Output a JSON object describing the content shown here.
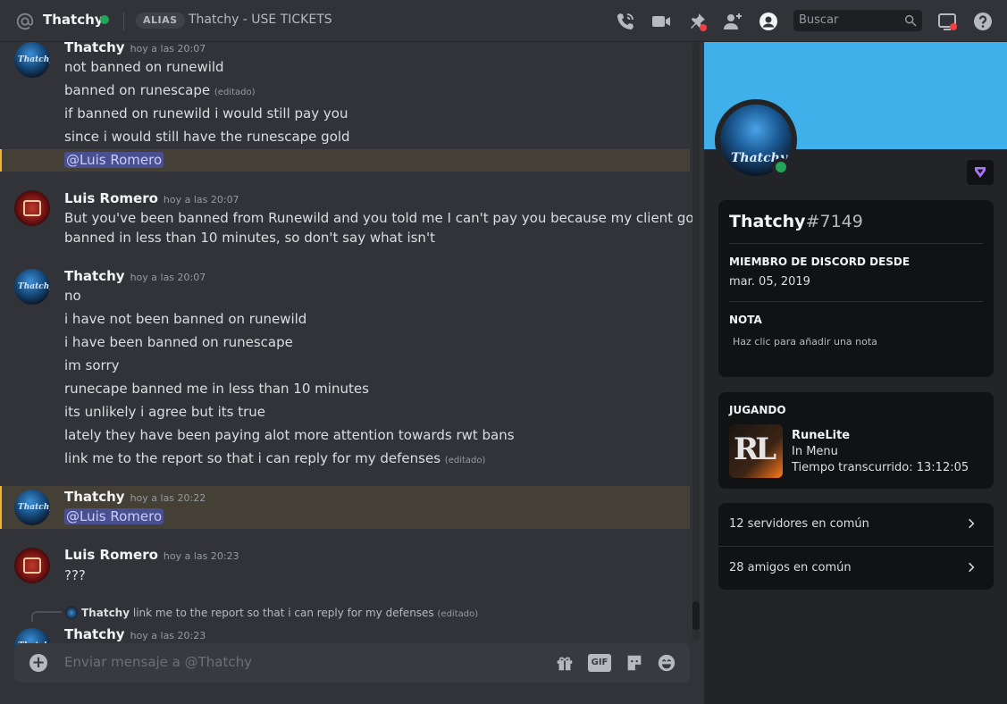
{
  "header": {
    "name": "Thatchy",
    "alias_tag": "ALIAS",
    "alias_text": "Thatchy - USE TICKETS",
    "search_placeholder": "Buscar",
    "icons": [
      "phone-call-icon",
      "video-call-icon",
      "pin-icon",
      "add-friend-icon",
      "profile-icon",
      "inbox-icon",
      "help-icon"
    ]
  },
  "messages": [
    {
      "author": "Thatchy",
      "time": "hoy a las 20:07",
      "lines": [
        {
          "text": "not banned on runewild"
        },
        {
          "text": "banned on runescape",
          "edited": "(editado)"
        },
        {
          "text": "if banned on runewild i would still pay you"
        },
        {
          "text": "since i would still have the runescape gold"
        },
        {
          "mention": "@Luis Romero"
        }
      ]
    },
    {
      "author": "Luis Romero",
      "time": "hoy a las 20:07",
      "lines": [
        {
          "text": "But you've been banned from Runewild and you told me I can't pay you because my client got"
        },
        {
          "text": "banned in less than 10 minutes, so don't say what isn't"
        }
      ]
    },
    {
      "author": "Thatchy",
      "time": "hoy a las 20:07",
      "lines": [
        {
          "text": "no"
        },
        {
          "text": "i have not been banned on runewild"
        },
        {
          "text": "i have been banned on runescape"
        },
        {
          "text": "im sorry"
        },
        {
          "text": "runecape banned me in less than 10 minutes"
        },
        {
          "text": "its unlikely i agree but its true"
        },
        {
          "text": "lately they have been paying alot more attention towards rwt bans"
        },
        {
          "text": "link me to the report so that i can reply for my defenses",
          "edited": "(editado)"
        }
      ]
    },
    {
      "author": "Thatchy",
      "time": "hoy a las 20:22",
      "lines": [
        {
          "mention": "@Luis Romero"
        }
      ]
    },
    {
      "author": "Luis Romero",
      "time": "hoy a las 20:23",
      "lines": [
        {
          "text": "???"
        }
      ]
    },
    {
      "author": "Thatchy",
      "time": "hoy a las 20:23",
      "reply": {
        "author": "Thatchy",
        "text": "link me to the report so that i can reply for my defenses",
        "edited": "(editado)"
      }
    }
  ],
  "composer": {
    "placeholder": "Enviar mensaje a @Thatchy",
    "gif_label": "GIF"
  },
  "profile": {
    "avatar_text": "Thatchy",
    "username": "Thatchy",
    "discriminator": "#7149",
    "member_since_title": "MIEMBRO DE DISCORD DESDE",
    "member_since": "mar. 05, 2019",
    "note_title": "NOTA",
    "note_placeholder": "Haz clic para añadir una nota",
    "playing_title": "JUGANDO",
    "game": {
      "name": "RuneLite",
      "state": "In Menu",
      "elapsed": "Tiempo transcurrido: 13:12:05",
      "art_text": "RL"
    },
    "mutual_servers": "12 servidores en común",
    "mutual_friends": "28 amigos en común",
    "colors": {
      "banner": "#3fb0ea",
      "status": "#23a55a"
    }
  }
}
